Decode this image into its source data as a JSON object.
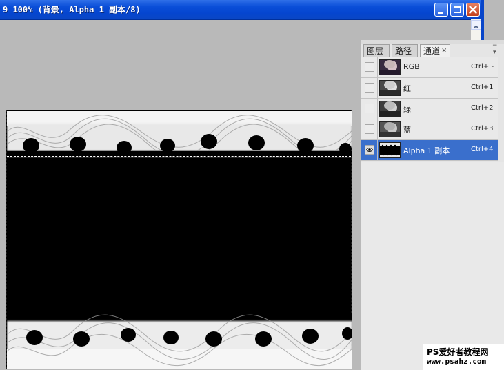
{
  "window": {
    "title": "9 100% (背景, Alpha 1 副本/8)"
  },
  "colors": {
    "titlebar": "#0545cf",
    "selected_row": "#3a6fcc",
    "canvas": "#000000",
    "workspace": "#b9b9b9"
  },
  "panel": {
    "tabs": [
      {
        "label": "图层",
        "active": false
      },
      {
        "label": "路径",
        "active": false
      },
      {
        "label": "通道",
        "active": true
      }
    ],
    "tab_close": "×",
    "menu_icon": "panel-menu-icon",
    "channels": [
      {
        "name": "RGB",
        "shortcut": "Ctrl+~",
        "visible": false,
        "selected": false,
        "thumb": "color-portrait"
      },
      {
        "name": "红",
        "shortcut": "Ctrl+1",
        "visible": false,
        "selected": false,
        "thumb": "gray-portrait"
      },
      {
        "name": "绿",
        "shortcut": "Ctrl+2",
        "visible": false,
        "selected": false,
        "thumb": "gray-portrait"
      },
      {
        "name": "蓝",
        "shortcut": "Ctrl+3",
        "visible": false,
        "selected": false,
        "thumb": "gray-portrait"
      },
      {
        "name": "Alpha 1 副本",
        "shortcut": "Ctrl+4",
        "visible": true,
        "selected": true,
        "thumb": "alpha-mask"
      }
    ]
  },
  "watermark": {
    "line1": "PS爱好者教程网",
    "line2": "www.psahz.com"
  }
}
